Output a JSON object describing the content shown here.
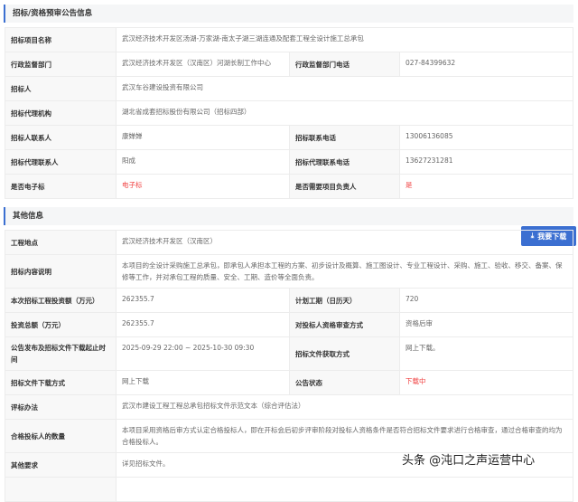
{
  "section1": {
    "title": "招标/资格预审公告信息",
    "rows": [
      {
        "l1": "招标项目名称",
        "v1": "武汉经济技术开发区汤湖-万家湖-南太子湖三湖连通及配套工程全设计施工总承包"
      },
      {
        "l1": "行政监督部门",
        "v1": "武汉经济技术开发区（汉南区）河湖长制工作中心",
        "l2": "行政监督部门电话",
        "v2": "027-84399632"
      },
      {
        "l1": "招标人",
        "v1": "武汉车谷建设投资有限公司"
      },
      {
        "l1": "招标代理机构",
        "v1": "湖北省成套招标股份有限公司（招标四部）"
      },
      {
        "l1": "招标人联系人",
        "v1": "康婵婵",
        "l2": "招标联系电话",
        "v2": "13006136085"
      },
      {
        "l1": "招标代理联系人",
        "v1": "阳成",
        "l2": "招标代理联系电话",
        "v2": "13627231281"
      },
      {
        "l1": "是否电子标",
        "v1": "电子标",
        "l2": "是否需要项目负责人",
        "v2": "是"
      }
    ]
  },
  "section2": {
    "title": "其他信息",
    "rows": [
      {
        "l1": "工程地点",
        "v1": "武汉经济技术开发区（汉南区）"
      },
      {
        "l1": "招标内容说明",
        "v1": "本项目的全设计采购施工总承包，即承包人承担本工程的方案、初步设计及概算、施工图设计、专业工程设计、采购、施工、验收、移交、备案、保修等工作，并对承包工程的质量、安全、工期、造价等全面负责。"
      },
      {
        "l1": "本次招标工程投资额（万元）",
        "v1": "262355.7",
        "l2": "计划工期（日历天）",
        "v2": "720"
      },
      {
        "l1": "投资总额（万元）",
        "v1": "262355.7",
        "l2": "对投标人资格审查方式",
        "v2": "资格后审"
      },
      {
        "l1": "公告发布及招标文件下载起止时间",
        "v1": "2025-09-29 22:00 ~ 2025-10-30 09:30",
        "l2": "招标文件获取方式",
        "v2": "网上下载。"
      },
      {
        "l1": "招标文件下载方式",
        "v1": "网上下载",
        "l2": "公告状态",
        "v2": "下载中"
      },
      {
        "l1": "评标办法",
        "v1": "武汉市建设工程工程总承包招标文件示范文本（综合评估法）"
      },
      {
        "l1": "合格投标人的数量",
        "v1": "本项目采用资格后审方式认定合格投标人，即在开标会后初步评审阶段对投标人资格条件是否符合招标文件要求进行合格审查，通过合格审查的均为合格投标人。"
      },
      {
        "l1": "其他要求",
        "v1": "详见招标文件。"
      }
    ]
  },
  "download_button": {
    "label": "我要下载",
    "icon": "download-icon"
  },
  "watermark": "头条 @沌口之声运营中心"
}
